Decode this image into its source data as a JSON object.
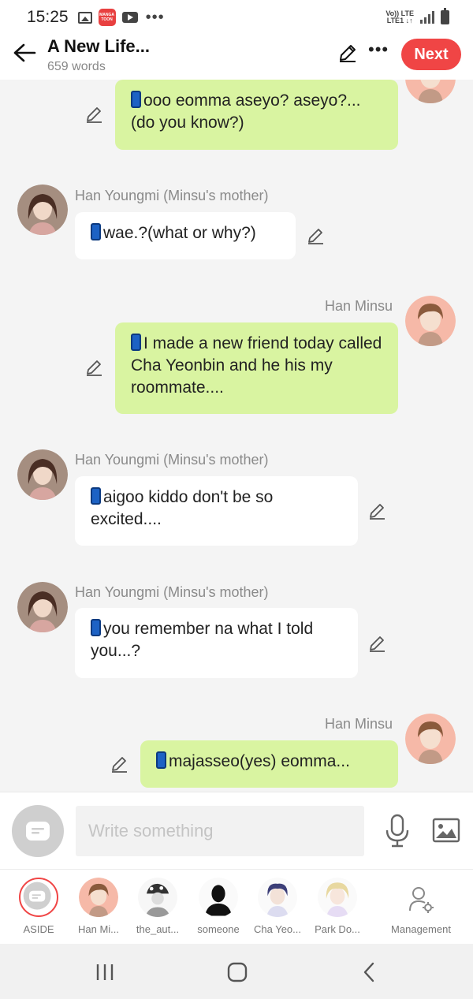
{
  "status_bar": {
    "time": "15:25",
    "manga_badge": "MANGA TOON",
    "network_top": "Vo)) LTE",
    "network_bottom": "LTE1 ↓↑",
    "icons": [
      "gallery-icon",
      "mangatoon-icon",
      "youtube-icon",
      "more-dots-icon",
      "signal-icon",
      "battery-icon"
    ]
  },
  "header": {
    "title": "A New Life...",
    "word_count": "659 words",
    "next_label": "Next",
    "accent_color": "#f04545"
  },
  "messages": [
    {
      "side": "right",
      "speaker": "",
      "text": "ooo eomma aseyo? aseyo?...(do you know?)"
    },
    {
      "side": "left",
      "speaker": "Han Youngmi (Minsu's mother)",
      "text": "wae.?(what or why?)"
    },
    {
      "side": "right",
      "speaker": "Han Minsu",
      "text": "I made a new friend today called Cha Yeonbin and he his my roommate...."
    },
    {
      "side": "left",
      "speaker": "Han Youngmi (Minsu's mother)",
      "text": "aigoo kiddo don't be so excited...."
    },
    {
      "side": "left",
      "speaker": "Han Youngmi (Minsu's mother)",
      "text": "you remember na what I told you...?"
    },
    {
      "side": "right",
      "speaker": "Han Minsu",
      "text": "majasseo(yes) eomma..."
    }
  ],
  "composer": {
    "placeholder": "Write something"
  },
  "characters": [
    {
      "label": "ASIDE"
    },
    {
      "label": "Han Mi..."
    },
    {
      "label": "the_aut..."
    },
    {
      "label": "someone"
    },
    {
      "label": "Cha Yeo..."
    },
    {
      "label": "Park Do..."
    },
    {
      "label": "Management"
    }
  ],
  "colors": {
    "my_bubble": "#d9f4a1",
    "their_bubble": "#ffffff",
    "background": "#f4f4f4"
  }
}
